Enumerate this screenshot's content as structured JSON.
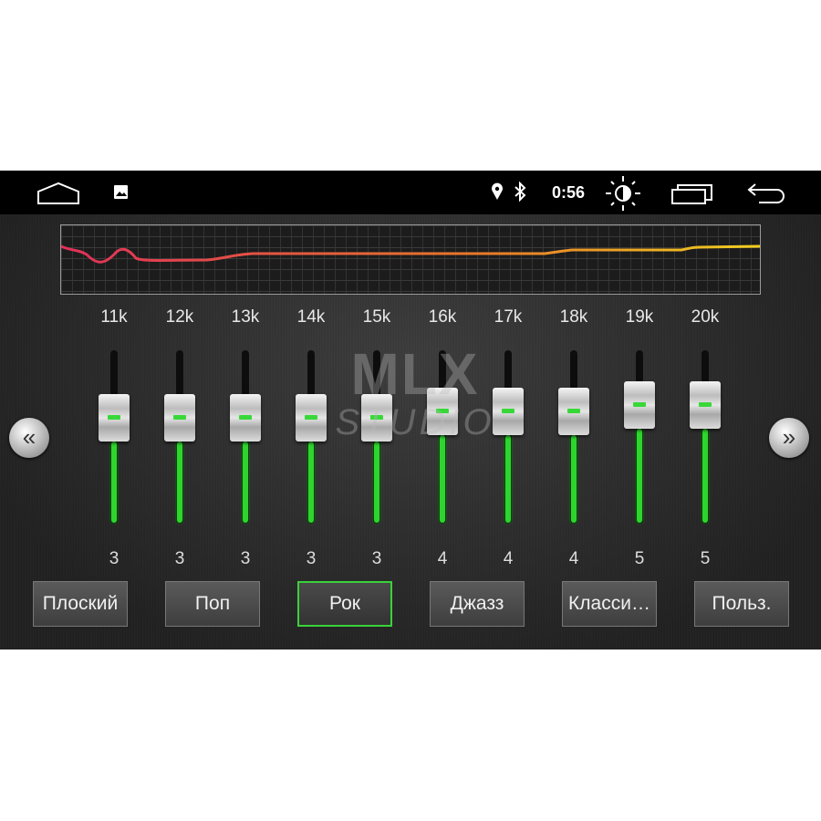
{
  "status_bar": {
    "time": "0:56",
    "icons": [
      "home-icon",
      "gallery-icon",
      "location-icon",
      "bluetooth-icon",
      "brightness-icon",
      "recent-apps-icon",
      "back-icon"
    ]
  },
  "watermark": {
    "text": "MLX STUDIO"
  },
  "colors": {
    "accent": "#3ad23a",
    "curve_start": "#e0305a",
    "curve_mid": "#e87a2a",
    "curve_end": "#f0d020"
  },
  "equalizer": {
    "bands": [
      {
        "label": "11k",
        "value": 3
      },
      {
        "label": "12k",
        "value": 3
      },
      {
        "label": "13k",
        "value": 3
      },
      {
        "label": "14k",
        "value": 3
      },
      {
        "label": "15k",
        "value": 3
      },
      {
        "label": "16k",
        "value": 4
      },
      {
        "label": "17k",
        "value": 4
      },
      {
        "label": "18k",
        "value": 4
      },
      {
        "label": "19k",
        "value": 5
      },
      {
        "label": "20k",
        "value": 5
      }
    ]
  },
  "presets": [
    {
      "label": "Плоский",
      "active": false
    },
    {
      "label": "Поп",
      "active": false
    },
    {
      "label": "Рок",
      "active": true
    },
    {
      "label": "Джазз",
      "active": false
    },
    {
      "label": "Класси…",
      "active": false
    },
    {
      "label": "Польз.",
      "active": false
    }
  ],
  "nav": {
    "prev_icon": "double-chevron-left-icon",
    "next_icon": "double-chevron-right-icon",
    "prev": "«",
    "next": "»"
  }
}
